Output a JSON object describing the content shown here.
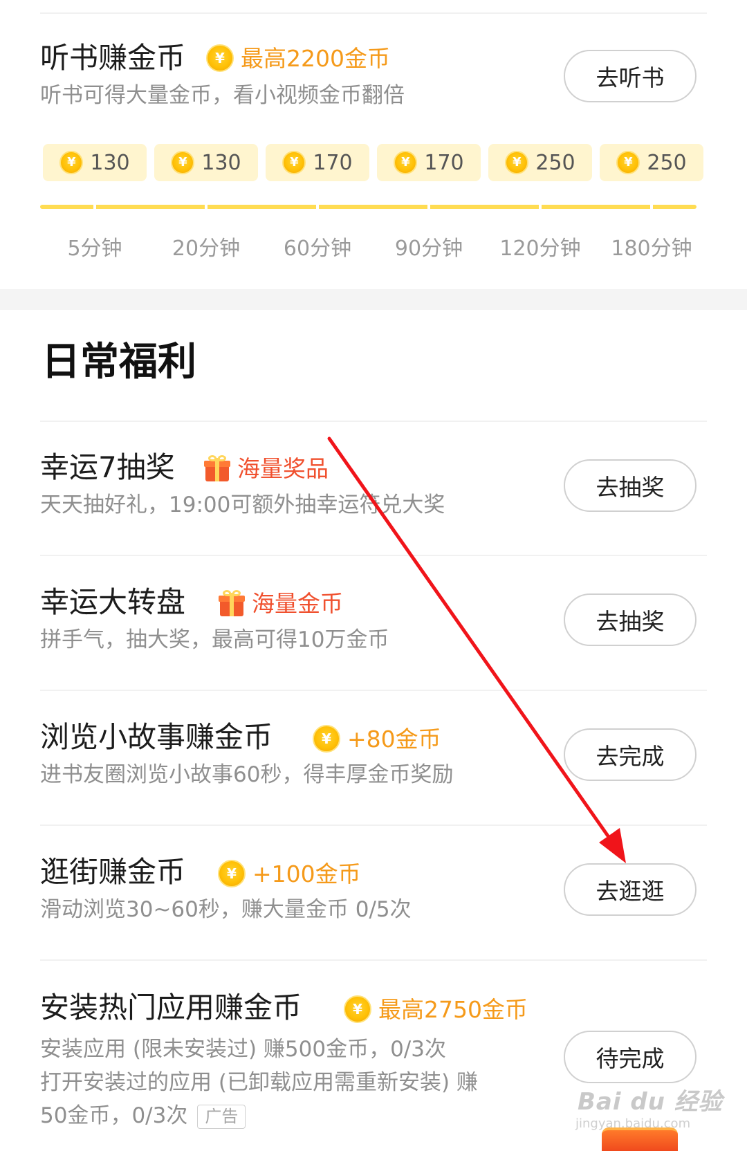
{
  "listen": {
    "title": "听书赚金币",
    "reward": "最高2200金币",
    "desc": "听书可得大量金币，看小视频金币翻倍",
    "button": "去听书",
    "milestones": [
      {
        "coins": "130",
        "time": "5分钟"
      },
      {
        "coins": "130",
        "time": "20分钟"
      },
      {
        "coins": "170",
        "time": "60分钟"
      },
      {
        "coins": "170",
        "time": "90分钟"
      },
      {
        "coins": "250",
        "time": "120分钟"
      },
      {
        "coins": "250",
        "time": "180分钟"
      }
    ]
  },
  "section_title": "日常福利",
  "tasks": [
    {
      "title": "幸运7抽奖",
      "reward": "海量奖品",
      "reward_icon": "gift-icon",
      "desc": "天天抽好礼，19:00可额外抽幸运符兑大奖",
      "button": "去抽奖"
    },
    {
      "title": "幸运大转盘",
      "reward": "海量金币",
      "reward_icon": "gift-icon",
      "desc": "拼手气，抽大奖，最高可得10万金币",
      "button": "去抽奖"
    },
    {
      "title": "浏览小故事赚金币",
      "reward": "+80金币",
      "reward_icon": "coin-icon",
      "desc": "进书友圈浏览小故事60秒，得丰厚金币奖励",
      "button": "去完成"
    },
    {
      "title": "逛街赚金币",
      "reward": "+100金币",
      "reward_icon": "coin-icon",
      "desc": "滑动浏览30~60秒，赚大量金币 0/5次",
      "button": "去逛逛"
    },
    {
      "title": "安装热门应用赚金币",
      "reward": "最高2750金币",
      "reward_icon": "coin-icon",
      "desc_lines": [
        "安装应用 (限未安装过) 赚500金币，0/3次",
        "打开安装过的应用 (已卸载应用需重新安装) 赚",
        "50金币，0/3次"
      ],
      "ad_tag": "广告",
      "button": "待完成"
    }
  ],
  "coin_symbol": "¥",
  "watermark": "Bai du 经验",
  "watermark_url": "jingyan.baidu.com",
  "colors": {
    "accent_orange": "#f59a1a",
    "accent_red": "#f0502e",
    "coin_gold": "#ffc107",
    "progress_yellow": "#ffdc52"
  }
}
